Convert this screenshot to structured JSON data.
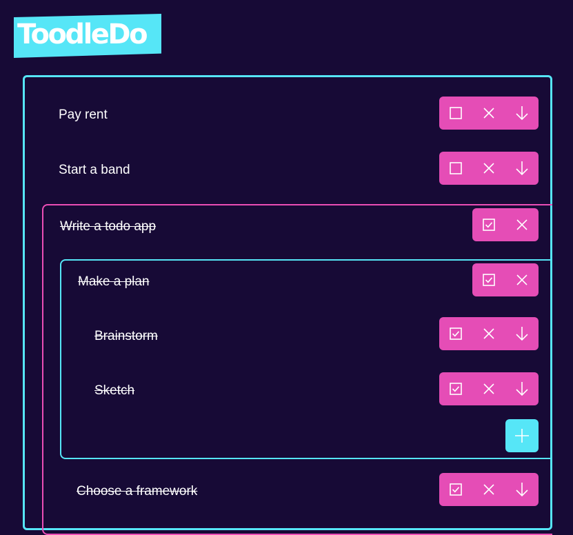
{
  "app": {
    "title": "ToodleDo"
  },
  "colors": {
    "background": "#170a36",
    "accent_cyan": "#56e6f7",
    "accent_pink": "#e54db6"
  },
  "todos": [
    {
      "label": "Pay rent",
      "done": false
    },
    {
      "label": "Start a band",
      "done": false
    },
    {
      "label": "Write a todo app",
      "done": true,
      "children": [
        {
          "label": "Make a plan",
          "done": true,
          "children": [
            {
              "label": "Brainstorm",
              "done": true
            },
            {
              "label": "Sketch",
              "done": true
            }
          ]
        },
        {
          "label": "Choose a framework",
          "done": true
        }
      ]
    }
  ],
  "icons": {
    "unchecked": "checkbox-unchecked-icon",
    "checked": "checkbox-checked-icon",
    "delete": "close-icon",
    "expand": "arrow-down-icon",
    "add": "plus-icon"
  }
}
